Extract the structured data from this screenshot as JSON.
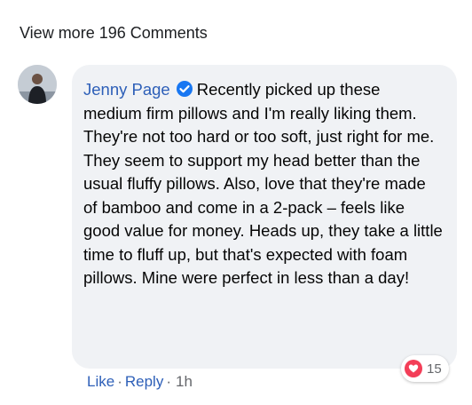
{
  "view_more": "View more 196 Comments",
  "comment": {
    "author": "Jenny Page",
    "text": "Recently picked up these medium firm pillows and I'm really liking them. They're not too hard or too soft, just right for me. They seem to support my head better than the usual fluffy pillows. Also, love that they're made of bamboo and come in a 2-pack – feels like good value for money. Heads up, they take a little time to fluff up, but that's expected with foam pillows. Mine were perfect in less than a day!",
    "reaction_count": "15",
    "actions": {
      "like": "Like",
      "reply": "Reply",
      "time": "1h"
    }
  },
  "colors": {
    "link": "#2d5fb8",
    "bubble": "#f0f2f5",
    "heart": "#f33e58",
    "verified": "#1877f2"
  },
  "icons": [
    "verified-badge-icon",
    "heart-icon"
  ]
}
